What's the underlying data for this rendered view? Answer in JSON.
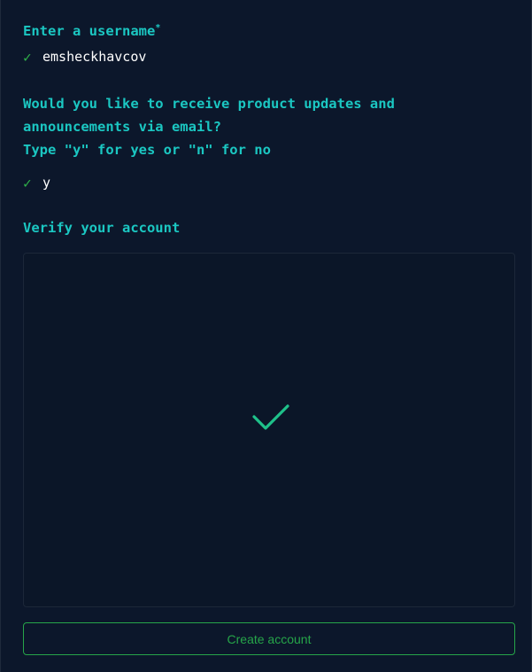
{
  "username": {
    "prompt": "Enter a username",
    "required_marker": "*",
    "check": "✓",
    "value": "emsheckhavcov"
  },
  "updates": {
    "prompt_line1": "Would you like to receive product updates and",
    "prompt_line2": "announcements via email?",
    "prompt_line3": "Type \"y\" for yes or \"n\" for no",
    "check": "✓",
    "value": "y"
  },
  "verify": {
    "prompt": "Verify your account",
    "status_icon": "checkmark-icon",
    "status_color": "#1fc18a"
  },
  "actions": {
    "create_label": "Create account"
  },
  "colors": {
    "background": "#0c172b",
    "prompt": "#1bc7c2",
    "success": "#2fb34a",
    "button": "#26a549"
  }
}
